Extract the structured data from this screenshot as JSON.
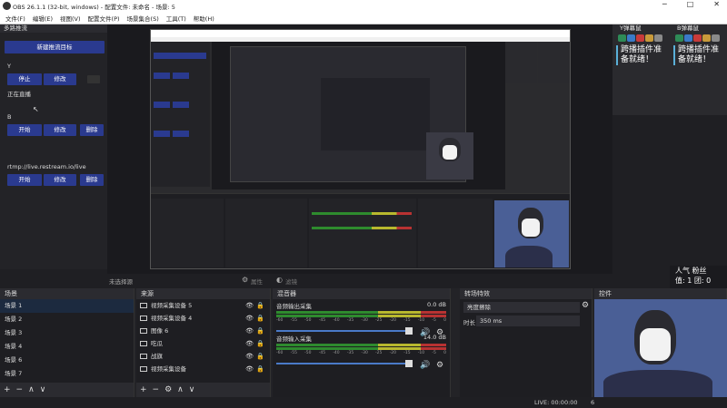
{
  "window": {
    "title": "OBS 26.1.1 (32-bit, windows) - 配置文件: 未命名 - 场景: 5",
    "minimize": "─",
    "maximize": "□",
    "close": "✕"
  },
  "menu": [
    "文件(F)",
    "编辑(E)",
    "视图(V)",
    "配置文件(P)",
    "场景集合(S)",
    "工具(T)",
    "帮助(H)"
  ],
  "multistream": {
    "title": "多路推流",
    "new_target": "新建推流目标",
    "targets": [
      {
        "name": "Y",
        "btn1": "停止",
        "btn2": "修改",
        "btn3": "",
        "status": "正在直播"
      },
      {
        "name": "B",
        "btn1": "开始",
        "btn2": "修改",
        "btn3": "删除"
      },
      {
        "name": "rtmp://live.restream.io/live",
        "btn1": "开始",
        "btn2": "修改",
        "btn3": "删除"
      }
    ]
  },
  "chat_docks": [
    {
      "title": "Y弹幕鼠",
      "message": "跨播插件准备就绪！"
    },
    {
      "title": "B弹幕鼠",
      "message": "跨播插件准备就绪！"
    }
  ],
  "stats": {
    "popularity": "人气",
    "fans": "粉丝",
    "val_label": "值: 1",
    "fans_val": "团: 0"
  },
  "transition": {
    "label": "未选择源",
    "props": "属性",
    "filters": "滤镜"
  },
  "scenes": {
    "title": "场景",
    "items": [
      "场景 1",
      "场景 2",
      "场景 3",
      "场景 4",
      "场景 6",
      "场景 7"
    ],
    "footer": [
      "+",
      "−",
      "∧",
      "∨"
    ]
  },
  "sources": {
    "title": "来源",
    "items": [
      "视频采集设备 5",
      "视频采集设备 4",
      "图像 6",
      "吃瓜",
      "战旗",
      "视频采集设备"
    ],
    "footer": [
      "+",
      "−",
      "⚙",
      "∧",
      "∨"
    ]
  },
  "mixer": {
    "title": "混音器",
    "channels": [
      {
        "name": "音频输出采集",
        "db": "0.0 dB",
        "ticks": [
          "-60",
          "-55",
          "-50",
          "-45",
          "-40",
          "-35",
          "-30",
          "-25",
          "-20",
          "-15",
          "-10",
          "-5",
          "0"
        ]
      },
      {
        "name": "音频输入采集",
        "db": "14.0 dB",
        "ticks": [
          "-60",
          "-55",
          "-50",
          "-45",
          "-40",
          "-35",
          "-30",
          "-25",
          "-20",
          "-15",
          "-10",
          "-5",
          "0"
        ]
      }
    ]
  },
  "transitions_dock": {
    "title": "转场特效",
    "selected": "亮度擦除",
    "duration_label": "时长",
    "duration_value": "350 ms"
  },
  "controls": {
    "title": "控件"
  },
  "status": {
    "live": "LIVE: 00:00:00",
    "rec": "6"
  },
  "colors": {
    "accent_blue": "#2a3a8f",
    "chat_border": "#5ab0d8"
  }
}
